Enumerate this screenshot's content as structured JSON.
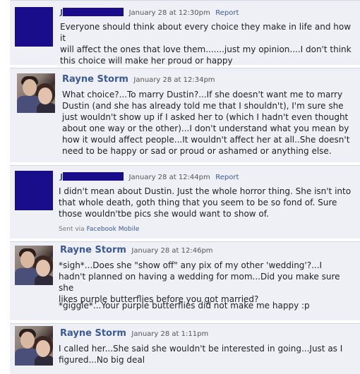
{
  "comments": [
    {
      "author_visible": "J",
      "date": "January 28 at 12:30pm",
      "report": "Report",
      "text": "Everyone should think about every choice they make in life and how it\nwill affect the ones that love them.......just my opinion....I don't think\nthis choice will make her proud or happy"
    },
    {
      "author": "Rayne Storm",
      "date": "January 28 at 12:34pm",
      "text": "What choice?...To marry Dustin?...If she doesn't want me to marry\nDustin (and she has already told me that I shouldn't), I'm sure she\njust wouldn't show up if I asked her to (which I hadn't even thought\nabout one way or the other)...I don't understand what you mean by\nhow it would affect people...It wouldn't affect her at all..She doesn't\nneed to be happy or sad or proud or ashamed or anything else."
    },
    {
      "author_visible": "J",
      "date": "January 28 at 12:44pm",
      "report": "Report",
      "text": "I didn't mean about Dustin. Just the whole horror thing. She isn't into\nthat whole death, goth thing that you seem to be so fond of. Sure\nthose wouldn'tbe pics she would want to show of.",
      "sent_prefix": "Sent via",
      "sent_app": "Facebook Mobile"
    },
    {
      "author": "Rayne Storm",
      "date": "January 28 at 12:46pm",
      "text": "*sigh*...Does she \"show off\" any pix of my other 'wedding'?...I\nhadn't planned on having a wedding for mom...Did you make sure she\nlikes purple butterflies before you got married?",
      "text2": "*giggle*...Your purple butterflies did not make me happy :p"
    },
    {
      "author": "Rayne Storm",
      "date": "January 28 at 1:11pm",
      "text": "I called her...She said she wouldn't be interested in going...Just as I\nfigured...No big deal"
    }
  ],
  "colors": {
    "link": "#3b5998",
    "redaction": "#1a0d8c",
    "post_bg": "#eef0f6"
  }
}
